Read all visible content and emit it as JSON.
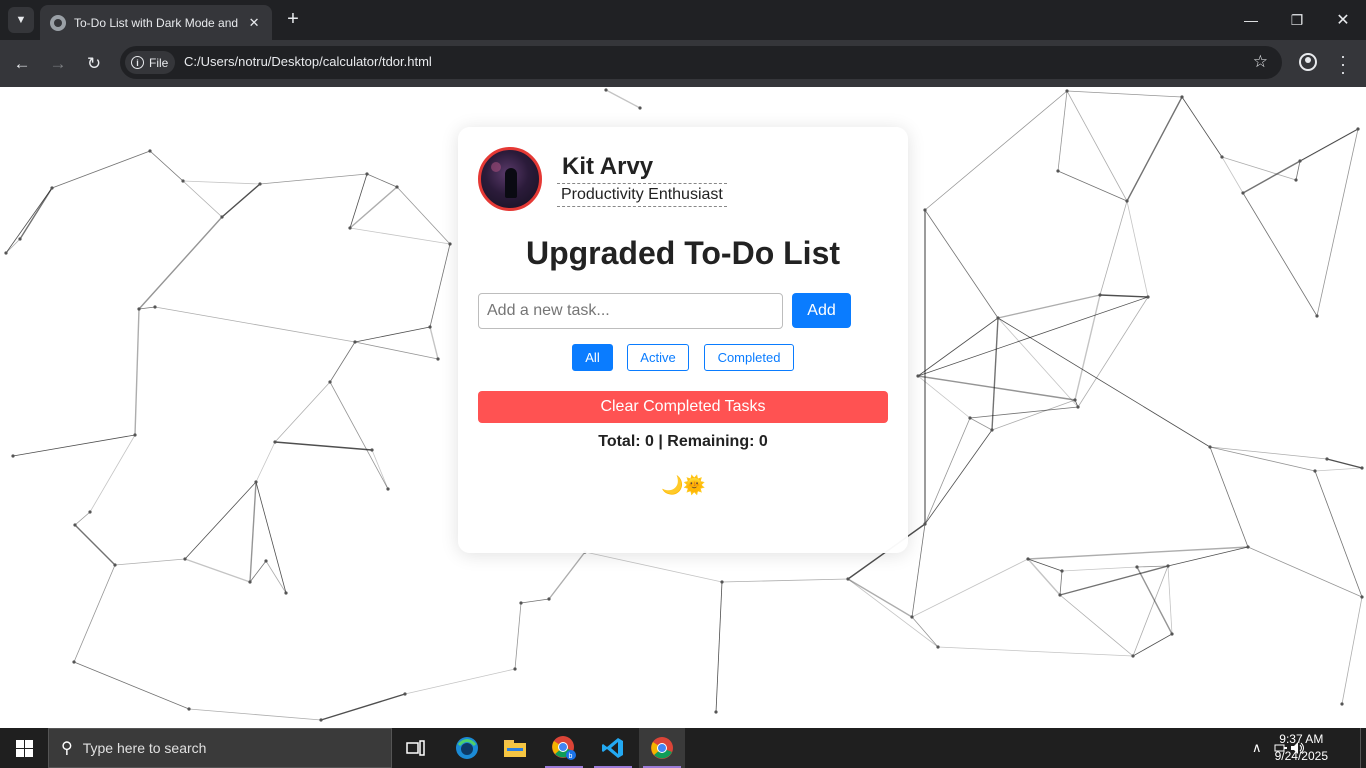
{
  "browser": {
    "tab_title": "To-Do List with Dark Mode and",
    "new_tab": "+",
    "address_chip": "File",
    "url": "C:/Users/notru/Desktop/calculator/tdor.html"
  },
  "profile": {
    "name": "Kit Arvy",
    "role": "Productivity Enthusiast"
  },
  "app": {
    "heading": "Upgraded To-Do List",
    "input_placeholder": "Add a new task...",
    "add_label": "Add",
    "filters": [
      "All",
      "Active",
      "Completed"
    ],
    "active_filter": "All",
    "clear_label": "Clear Completed Tasks",
    "stats": "Total: 0 | Remaining: 0",
    "theme_toggle": "🌙🌞"
  },
  "taskbar": {
    "search_placeholder": "Type here to search",
    "time": "9:37 AM",
    "date": "9/24/2025",
    "apps": [
      "task-view-icon",
      "edge-icon",
      "file-explorer-icon",
      "chrome-profile-icon",
      "vscode-icon",
      "chrome-icon"
    ]
  },
  "colors": {
    "accent": "#0a7cff",
    "danger": "#ff5252",
    "avatar_border": "#e53935"
  }
}
